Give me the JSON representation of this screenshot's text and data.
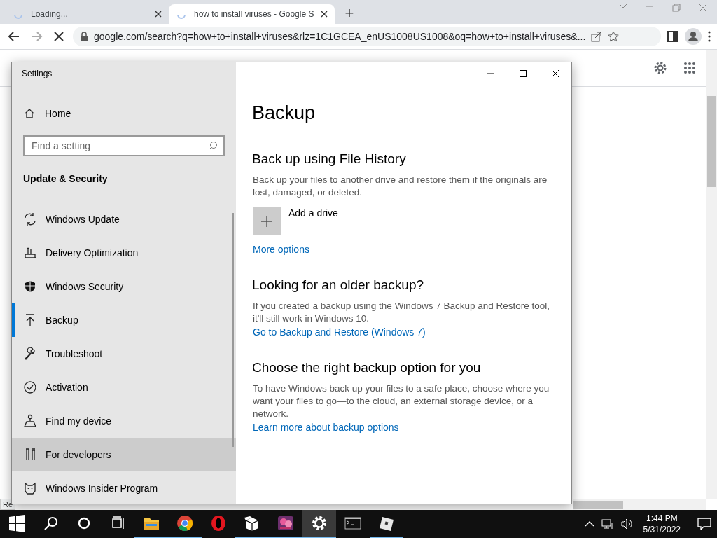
{
  "browser": {
    "tabs": [
      {
        "label": "Loading...",
        "selected": false,
        "loading": true
      },
      {
        "label": "how to install viruses - Google S",
        "selected": true,
        "loading": true
      }
    ],
    "new_tab": "+",
    "address": "google.com/search?q=how+to+install+viruses&rlz=1C1GCEA_enUS1008US1008&oq=how+to+install+viruses&...",
    "status": "Re"
  },
  "settings": {
    "title": "Settings",
    "home": "Home",
    "search": {
      "placeholder": "Find a setting"
    },
    "category": "Update & Security",
    "nav": [
      {
        "label": "Windows Update",
        "kind": "sync",
        "selected": false,
        "hovered": false
      },
      {
        "label": "Delivery Optimization",
        "kind": "delivery",
        "selected": false,
        "hovered": false
      },
      {
        "label": "Windows Security",
        "kind": "shield",
        "selected": false,
        "hovered": false
      },
      {
        "label": "Backup",
        "kind": "backup",
        "selected": true,
        "hovered": false
      },
      {
        "label": "Troubleshoot",
        "kind": "wrench",
        "selected": false,
        "hovered": false
      },
      {
        "label": "Activation",
        "kind": "check",
        "selected": false,
        "hovered": false
      },
      {
        "label": "Find my device",
        "kind": "person",
        "selected": false,
        "hovered": false
      },
      {
        "label": "For developers",
        "kind": "tools",
        "selected": false,
        "hovered": true
      },
      {
        "label": "Windows Insider Program",
        "kind": "cat",
        "selected": false,
        "hovered": false
      }
    ],
    "page": {
      "title": "Backup",
      "sections": [
        {
          "heading": "Back up using File History",
          "text": "Back up your files to another drive and restore them if the originals are lost, damaged, or deleted.",
          "tile": "Add a drive",
          "link": "More options"
        },
        {
          "heading": "Looking for an older backup?",
          "text": "If you created a backup using the Windows 7 Backup and Restore tool, it'll still work in Windows 10.",
          "link": "Go to Backup and Restore (Windows 7)"
        },
        {
          "heading": "Choose the right backup option for you",
          "text": "To have Windows back up your files to a safe place, choose where you want your files to go—to the cloud, an external storage device, or a network.",
          "link": "Learn more about backup options"
        }
      ]
    }
  },
  "taskbar": {
    "apps": [
      {
        "kind": "folder",
        "running": true,
        "active": false
      },
      {
        "kind": "chrome",
        "running": true,
        "active": false
      },
      {
        "kind": "opera",
        "running": false,
        "active": false
      },
      {
        "kind": "box",
        "running": true,
        "active": false
      },
      {
        "kind": "game",
        "running": true,
        "active": false
      },
      {
        "kind": "gear",
        "running": true,
        "active": true
      },
      {
        "kind": "terminal",
        "running": false,
        "active": false
      },
      {
        "kind": "cube",
        "running": true,
        "active": false
      }
    ],
    "time": "1:44 PM",
    "date": "5/31/2022"
  }
}
